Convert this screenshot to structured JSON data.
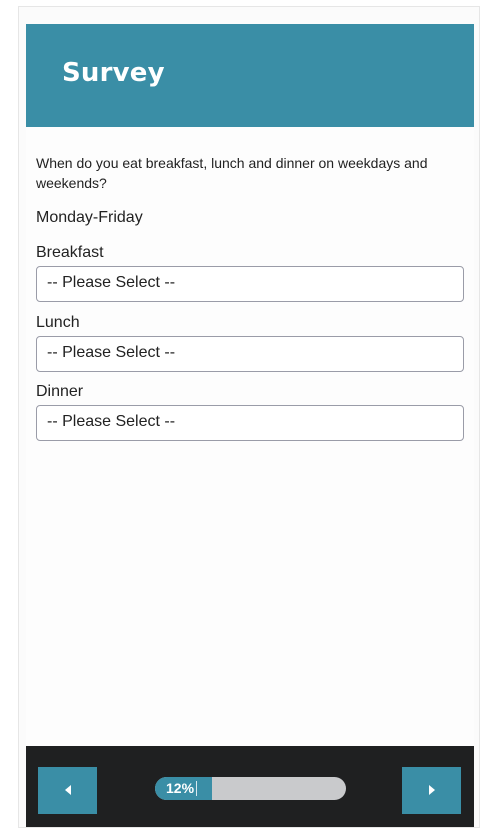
{
  "header": {
    "title": "Survey"
  },
  "question": {
    "text": "When do you eat breakfast, lunch and dinner on weekdays and weekends?"
  },
  "group": {
    "label": "Monday-Friday"
  },
  "fields": [
    {
      "label": "Breakfast",
      "value": "-- Please Select --"
    },
    {
      "label": "Lunch",
      "value": "-- Please Select --"
    },
    {
      "label": "Dinner",
      "value": "-- Please Select --"
    }
  ],
  "footer": {
    "prev_icon": "chevron-left-icon",
    "next_icon": "chevron-right-icon",
    "progress_text": "12%",
    "progress_value": 0.12
  },
  "colors": {
    "accent": "#3a8ea6",
    "footer_bg": "#1f2021",
    "progress_track": "#c9cacc"
  }
}
